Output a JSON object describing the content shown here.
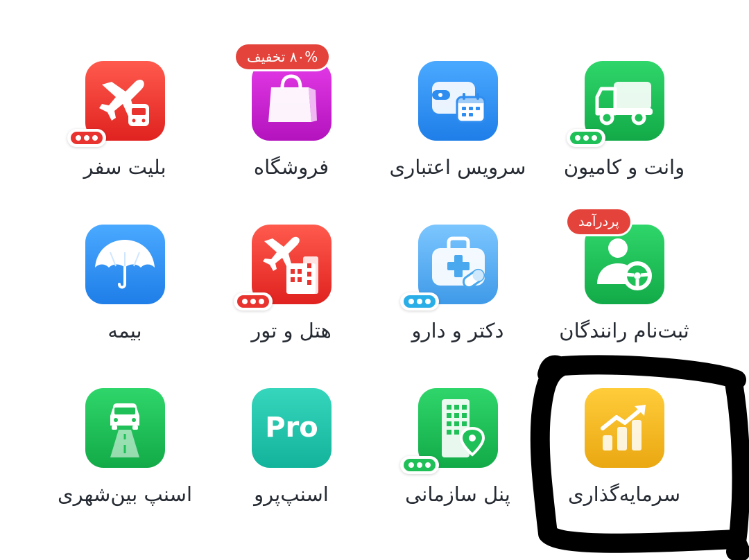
{
  "rows": [
    [
      {
        "label": "بلیت سفر",
        "icon": "airplane-bus-icon",
        "color": "#e8332e"
      },
      {
        "label": "فروشگاه",
        "icon": "shopping-bag-icon",
        "color": "#c41fc9",
        "badge": "۸۰% تخفیف"
      },
      {
        "label": "سرویس اعتباری",
        "icon": "wallet-calendar-icon",
        "color": "#2f8df0"
      },
      {
        "label": "وانت و کامیون",
        "icon": "truck-icon",
        "color": "#1fc058"
      }
    ],
    [
      {
        "label": "بیمه",
        "icon": "umbrella-icon",
        "color": "#2f8df0"
      },
      {
        "label": "هتل و تور",
        "icon": "airplane-hotel-icon",
        "color": "#e8332e"
      },
      {
        "label": "دکتر و دارو",
        "icon": "medical-bag-icon",
        "color": "#49a8ee"
      },
      {
        "label": "ثبت‌نام رانندگان",
        "icon": "driver-user-icon",
        "color": "#1fc058",
        "badge": "پردرآمد"
      }
    ],
    [
      {
        "label": "اسنپ بین‌شهری",
        "icon": "car-road-icon",
        "color": "#1fc058"
      },
      {
        "label": "اسنپ‌پرو",
        "icon": "pro-text-icon",
        "color": "#1fc2a8",
        "icon_text": "Pro"
      },
      {
        "label": "پنل سازمانی",
        "icon": "office-building-location-icon",
        "color": "#1fc058"
      },
      {
        "label": "سرمایه‌گذاری",
        "icon": "investment-chart-icon",
        "color": "#f2b71f"
      }
    ]
  ],
  "colors": {
    "red_dots": "#e8332e",
    "green_dots": "#1fc058",
    "blue_dots": "#2aaee8",
    "badge_bg": "#e4433b",
    "scribble": "#000000"
  }
}
